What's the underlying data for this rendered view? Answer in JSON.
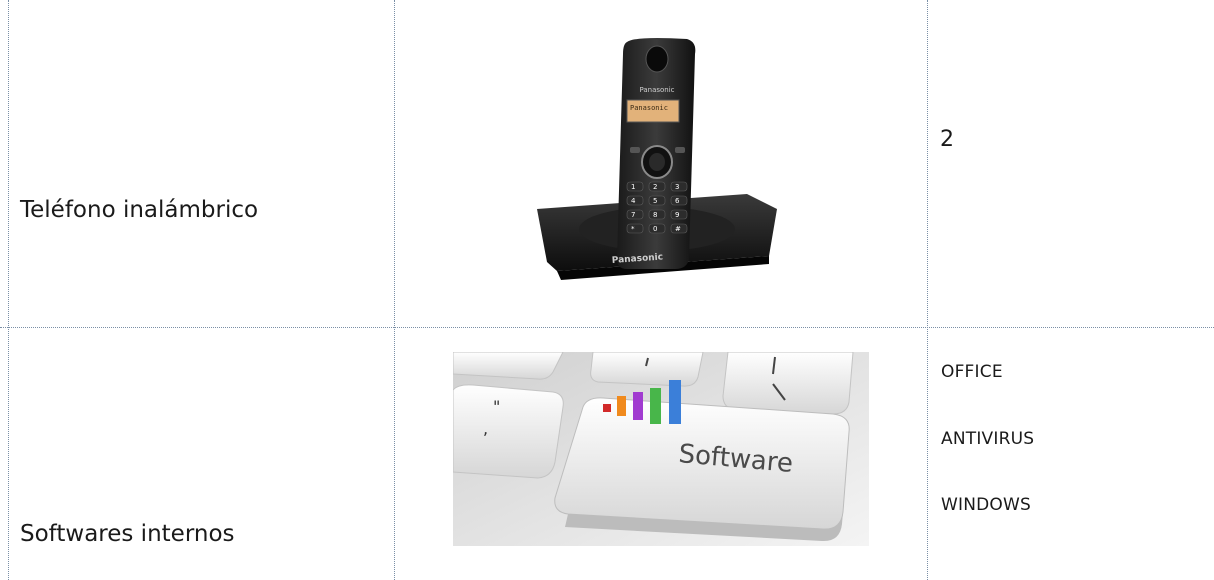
{
  "rows": [
    {
      "item": "Teléfono inalámbrico",
      "image": {
        "icon": "cordless-phone-icon",
        "brand": "Panasonic",
        "screen": "Panasonic",
        "keys": [
          "1",
          "2",
          "3",
          "4",
          "5",
          "6",
          "7",
          "8",
          "9",
          "*",
          "0",
          "#"
        ]
      },
      "quantity": "2"
    },
    {
      "item": "Softwares internos",
      "image": {
        "icon": "software-key-icon",
        "key_label": "Software"
      },
      "software": [
        "OFFICE",
        "ANTIVIRUS",
        "WINDOWS"
      ]
    }
  ]
}
